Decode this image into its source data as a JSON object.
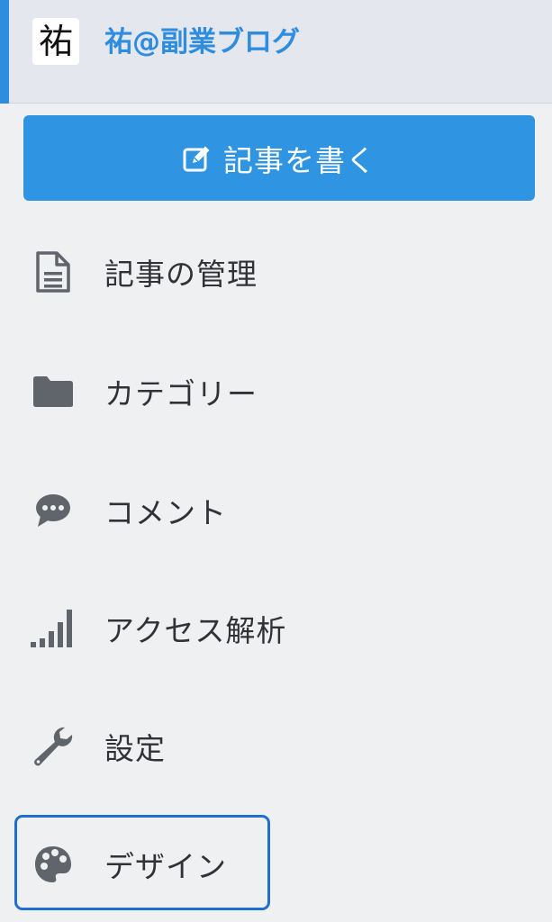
{
  "header": {
    "avatar_char": "祐",
    "blog_title": "祐@副業ブログ"
  },
  "write_button": {
    "label": "記事を書く"
  },
  "menu": {
    "items": [
      {
        "label": "記事の管理",
        "icon": "document-icon"
      },
      {
        "label": "カテゴリー",
        "icon": "folder-icon"
      },
      {
        "label": "コメント",
        "icon": "comment-icon"
      },
      {
        "label": "アクセス解析",
        "icon": "signal-icon"
      },
      {
        "label": "設定",
        "icon": "wrench-icon"
      },
      {
        "label": "デザイン",
        "icon": "palette-icon"
      }
    ]
  },
  "colors": {
    "accent": "#2f8de0",
    "button": "#2f95e3",
    "icon": "#60656c",
    "focus": "#1f6fd1"
  }
}
